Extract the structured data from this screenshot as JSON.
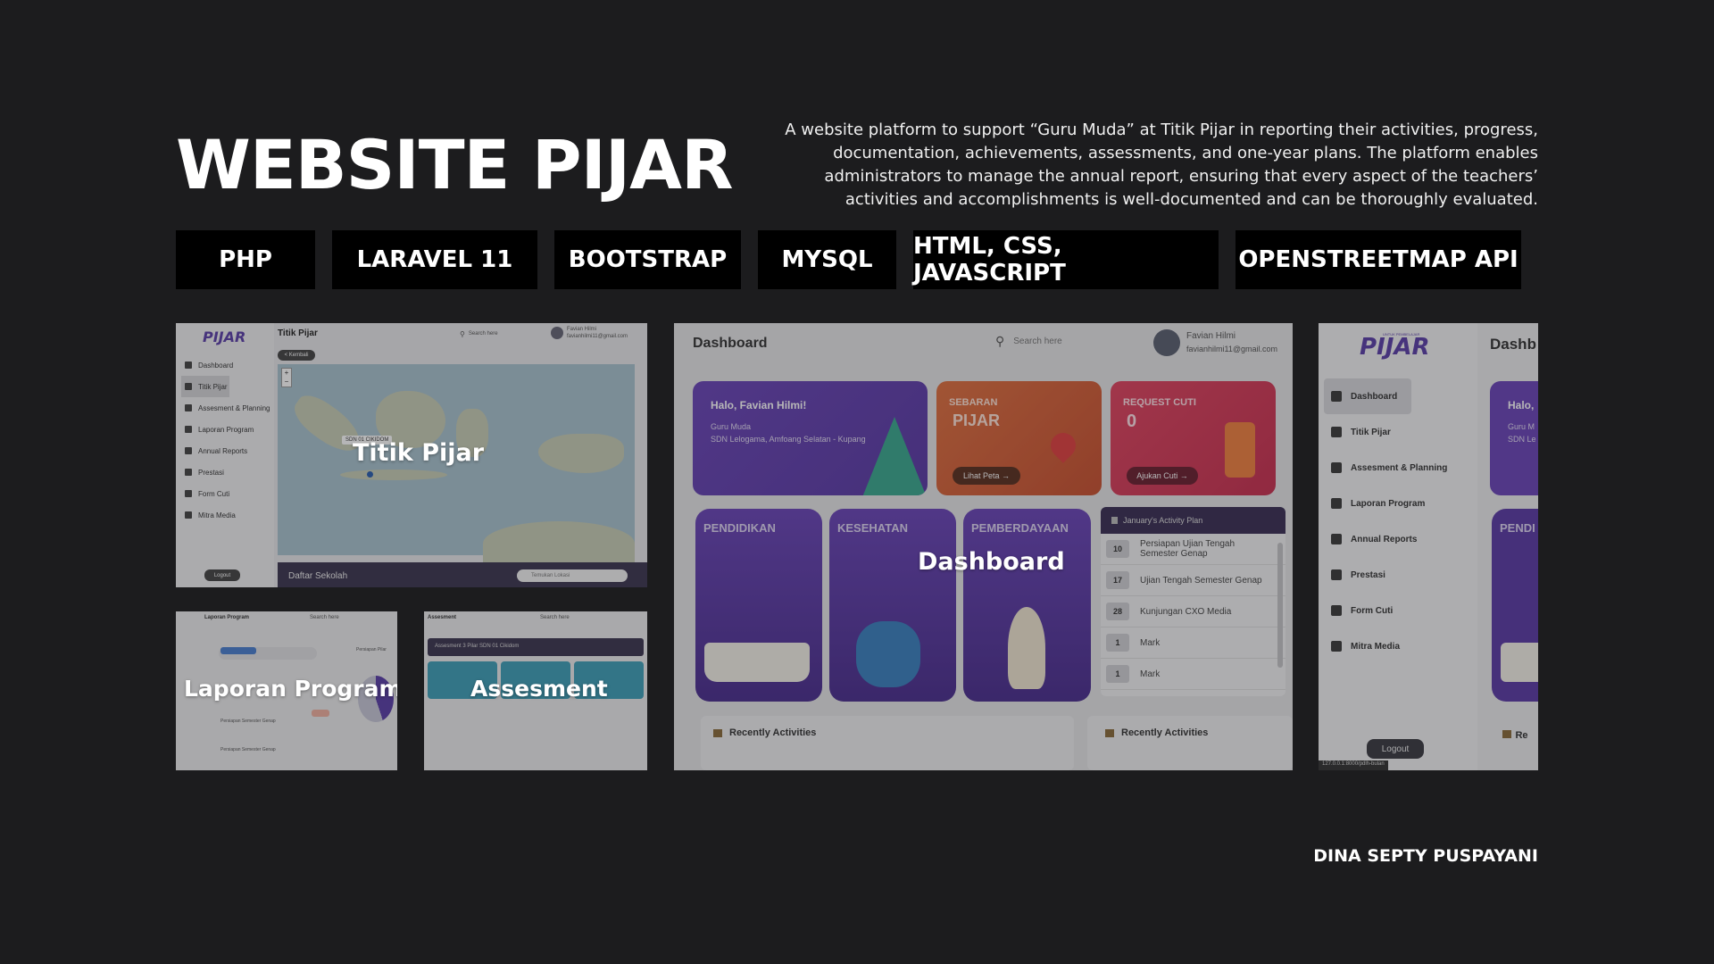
{
  "header": {
    "title": "WEBSITE PIJAR",
    "description": "A website platform to support “Guru Muda” at Titik Pijar in reporting their activities, progress, documentation, achievements, assessments, and one-year plans. The platform enables administrators to manage the annual report, ensuring that every aspect of the teachers’ activities and accomplishments is well-documented and can be thoroughly evaluated."
  },
  "tags": [
    "PHP",
    "LARAVEL 11",
    "BOOTSTRAP",
    "MYSQL",
    "HTML, CSS, JAVASCRIPT",
    "OPENSTREETMAP API"
  ],
  "labels": {
    "titik_pijar": "Titik Pijar",
    "laporan": "Laporan Program",
    "assesment": "Assesment",
    "dashboard": "Dashboard"
  },
  "titik_shot": {
    "logo": "PIJAR",
    "page_title": "Titik Pijar",
    "search_placeholder": "Search here",
    "user_name": "Favian Hilmi",
    "user_email": "favianhilmi11@gmail.com",
    "back_button": "< Kembali",
    "map_marker_label": "SDN 01 CIKIDOM",
    "sidebar": [
      "Dashboard",
      "Titik Pijar",
      "Assesment & Planning",
      "Laporan Program",
      "Annual Reports",
      "Prestasi",
      "Form Cuti",
      "Mitra Media"
    ],
    "logout": "Logout",
    "list_title": "Daftar Sekolah",
    "list_search": "Temukan Lokasi"
  },
  "laporan_shot": {
    "title": "Laporan Program",
    "search": "Search here",
    "side_title": "Persiapan Pilar",
    "rows": [
      "Persiapan Semester Genap",
      "Persiapan Semester Genap"
    ]
  },
  "assesment_shot": {
    "title": "Assesment",
    "search": "Search here",
    "banner": "Assesment 3 Pilar SDN 01 Cikidom"
  },
  "dashboard_shot": {
    "title": "Dashboard",
    "search_placeholder": "Search here",
    "user_name": "Favian Hilmi",
    "user_email": "favianhilmi11@gmail.com",
    "greeting": "Halo, Favian Hilmi!",
    "role": "Guru Muda",
    "school": "SDN Lelogama, Amfoang Selatan - Kupang",
    "sebaran_title": "SEBARAN",
    "sebaran_sub": "PIJAR",
    "sebaran_button": "Lihat Peta →",
    "cuti_title": "REQUEST CUTI",
    "cuti_count": "0",
    "cuti_button": "Ajukan Cuti →",
    "pillars": [
      "PENDIDIKAN",
      "KESEHATAN",
      "PEMBERDAYAAN"
    ],
    "plan_title": "January's Activity Plan",
    "plan_items": [
      {
        "day": "10",
        "text": "Persiapan Ujian Tengah Semester Genap"
      },
      {
        "day": "17",
        "text": "Ujian Tengah Semester Genap"
      },
      {
        "day": "28",
        "text": "Kunjungan CXO Media"
      },
      {
        "day": "1",
        "text": "Mark"
      },
      {
        "day": "1",
        "text": "Mark"
      }
    ],
    "recent_left": "Recently Activities",
    "recent_right": "Recently Activities"
  },
  "right_shot": {
    "logo": "PIJAR",
    "logo_small": "UNTUK PEMBELAJAR",
    "page_title": "Dashb",
    "sidebar": [
      "Dashboard",
      "Titik Pijar",
      "Assesment & Planning",
      "Laporan Program",
      "Annual Reports",
      "Prestasi",
      "Form Cuti",
      "Mitra Media"
    ],
    "logout": "Logout",
    "url": "127.0.0.1:8000/pdlh-bulan",
    "greeting": "Halo,",
    "role": "Guru M",
    "school": "SDN Le",
    "pillar": "PENDI",
    "recent": "Re"
  },
  "footer": {
    "author": "DINA SEPTY PUSPAYANI"
  },
  "colors": {
    "background": "#1c1c1e",
    "tag_bg": "#000000",
    "purple": "#5b3ea8",
    "orange": "#d9623a",
    "red": "#d63b5a"
  }
}
